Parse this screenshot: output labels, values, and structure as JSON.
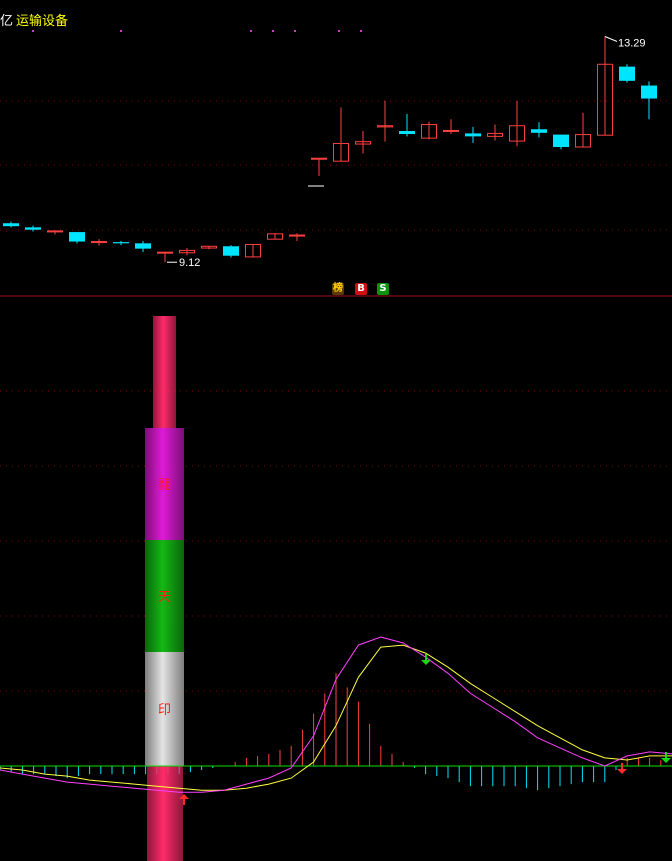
{
  "header": {
    "prefix": "亿",
    "sector": "运输设备"
  },
  "markers": {
    "rank_label": "榜",
    "buy_label": "B",
    "sell_label": "S"
  },
  "pillar": {
    "labels": [
      "翻",
      "天",
      "印"
    ],
    "colors": [
      "#ff2a6a",
      "#e01ad8",
      "#14b814",
      "#e4e4e4",
      "#ff2a6a"
    ]
  },
  "colors": {
    "up": "#ff4040",
    "down": "#00e5ff",
    "divider": "#a01018",
    "grid": "#8a0000",
    "dif": "#ff40ff",
    "dea": "#ffff40",
    "zero": "#00e000",
    "hist_pos": "#ff4040",
    "hist_neg": "#00e5ff"
  },
  "chart_data": [
    {
      "type": "candlestick",
      "high_annotation": "13.29",
      "low_annotation": "9.12",
      "ylim": [
        9.0,
        13.4
      ],
      "candles": [
        {
          "o": 10.13,
          "h": 10.16,
          "l": 10.06,
          "c": 10.08
        },
        {
          "o": 10.06,
          "h": 10.09,
          "l": 9.99,
          "c": 10.02
        },
        {
          "o": 9.99,
          "h": 10.01,
          "l": 9.94,
          "c": 10.0
        },
        {
          "o": 9.98,
          "h": 9.98,
          "l": 9.79,
          "c": 9.82
        },
        {
          "o": 9.82,
          "h": 9.86,
          "l": 9.75,
          "c": 9.82
        },
        {
          "o": 9.81,
          "h": 9.83,
          "l": 9.76,
          "c": 9.79
        },
        {
          "o": 9.79,
          "h": 9.83,
          "l": 9.64,
          "c": 9.7
        },
        {
          "o": 9.63,
          "h": 9.65,
          "l": 9.47,
          "c": 9.64
        },
        {
          "o": 9.63,
          "h": 9.71,
          "l": 9.59,
          "c": 9.67
        },
        {
          "o": 9.71,
          "h": 9.74,
          "l": 9.69,
          "c": 9.74
        },
        {
          "o": 9.74,
          "h": 9.76,
          "l": 9.55,
          "c": 9.58
        },
        {
          "o": 9.56,
          "h": 9.78,
          "l": 9.55,
          "c": 9.77
        },
        {
          "o": 9.86,
          "h": 9.96,
          "l": 9.86,
          "c": 9.95
        },
        {
          "o": 9.93,
          "h": 9.96,
          "l": 9.83,
          "c": 9.93
        },
        {
          "o": 11.23,
          "h": 11.23,
          "l": 10.93,
          "c": 11.23
        },
        {
          "o": 11.18,
          "h": 12.09,
          "l": 11.18,
          "c": 11.48
        },
        {
          "o": 11.47,
          "h": 11.69,
          "l": 11.31,
          "c": 11.51
        },
        {
          "o": 11.76,
          "h": 12.2,
          "l": 11.51,
          "c": 11.78
        },
        {
          "o": 11.69,
          "h": 11.98,
          "l": 11.6,
          "c": 11.64
        },
        {
          "o": 11.57,
          "h": 11.85,
          "l": 11.55,
          "c": 11.8
        },
        {
          "o": 11.69,
          "h": 11.89,
          "l": 11.64,
          "c": 11.7
        },
        {
          "o": 11.65,
          "h": 11.76,
          "l": 11.49,
          "c": 11.6
        },
        {
          "o": 11.6,
          "h": 11.8,
          "l": 11.53,
          "c": 11.65
        },
        {
          "o": 11.52,
          "h": 12.2,
          "l": 11.43,
          "c": 11.78
        },
        {
          "o": 11.72,
          "h": 11.84,
          "l": 11.58,
          "c": 11.66
        },
        {
          "o": 11.63,
          "h": 11.63,
          "l": 11.38,
          "c": 11.42
        },
        {
          "o": 11.42,
          "h": 12.0,
          "l": 11.42,
          "c": 11.63
        },
        {
          "o": 11.62,
          "h": 13.29,
          "l": 11.62,
          "c": 12.82
        },
        {
          "o": 12.78,
          "h": 12.82,
          "l": 12.51,
          "c": 12.54
        },
        {
          "o": 12.46,
          "h": 12.53,
          "l": 11.89,
          "c": 12.24
        }
      ]
    },
    {
      "type": "line",
      "ylim": [
        -0.2,
        0.81
      ],
      "series": [
        {
          "values": [
            -0.02,
            -0.04,
            -0.06,
            -0.08,
            -0.09,
            -0.1,
            -0.11,
            -0.12,
            -0.13,
            -0.13,
            -0.12,
            -0.09,
            -0.06,
            -0.01,
            0.15,
            0.43,
            0.6,
            0.64,
            0.61,
            0.54,
            0.46,
            0.36,
            0.29,
            0.22,
            0.14,
            0.09,
            0.04,
            0.0,
            0.05,
            0.07,
            0.06
          ]
        },
        {
          "values": [
            -0.01,
            -0.02,
            -0.04,
            -0.05,
            -0.07,
            -0.08,
            -0.09,
            -0.1,
            -0.11,
            -0.12,
            -0.12,
            -0.11,
            -0.09,
            -0.06,
            0.02,
            0.2,
            0.44,
            0.59,
            0.6,
            0.56,
            0.49,
            0.41,
            0.34,
            0.27,
            0.2,
            0.14,
            0.08,
            0.04,
            0.03,
            0.05,
            0.05
          ]
        }
      ]
    }
  ]
}
